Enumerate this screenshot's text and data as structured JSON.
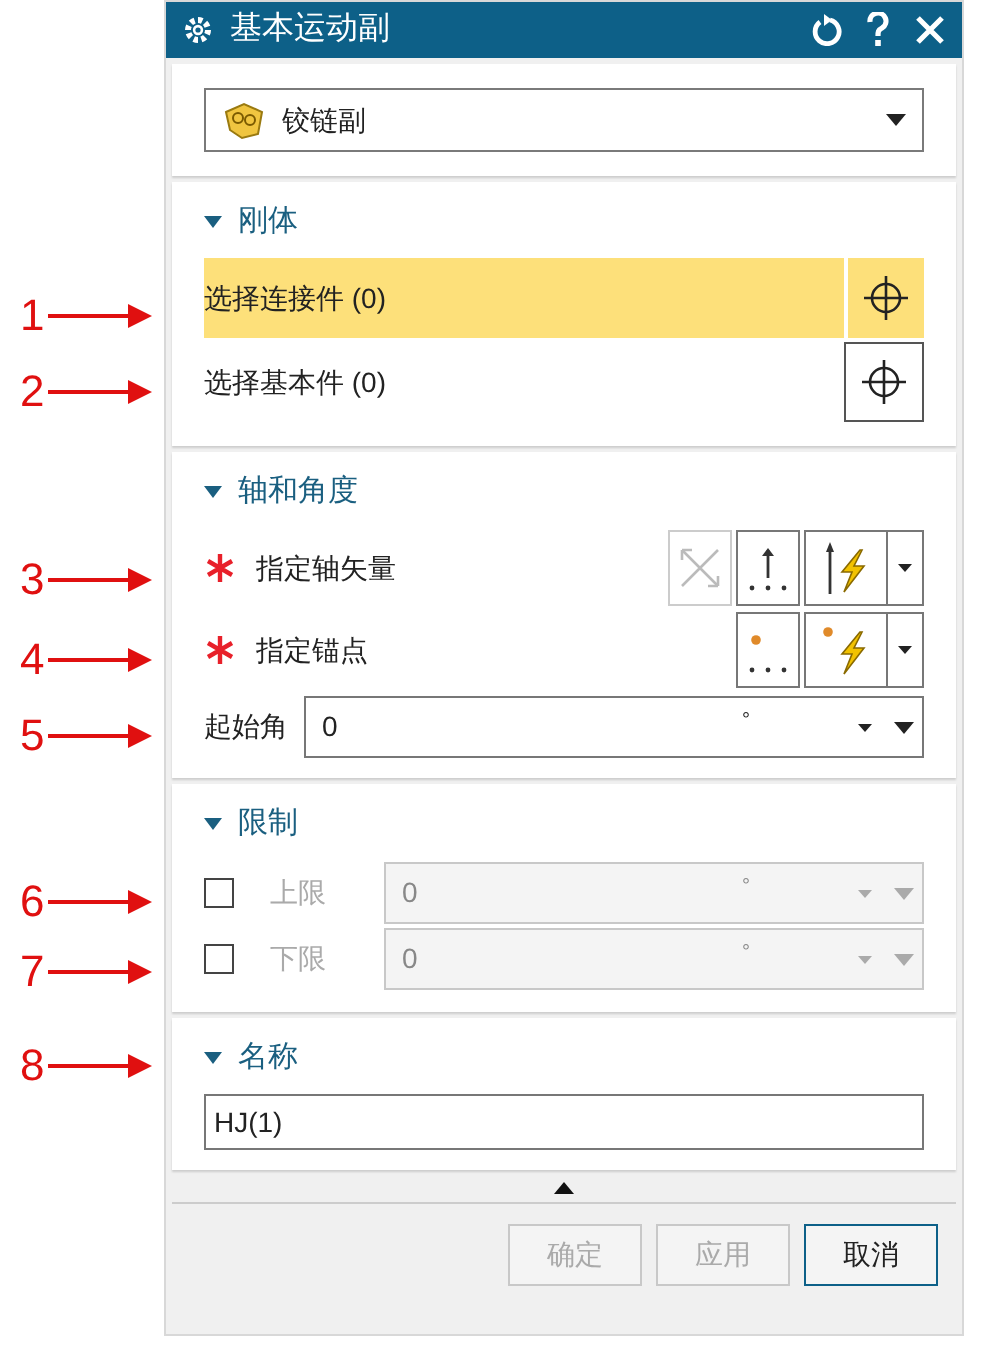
{
  "title_bar": {
    "title": "基本运动副"
  },
  "joint_type": {
    "value": "铰链副"
  },
  "sections": [
    {
      "kind": "rigid_body",
      "title": "刚体",
      "expanded": true,
      "rows": [
        {
          "label": "选择连接件 (0)",
          "selected": true
        },
        {
          "label": "选择基本件 (0)",
          "selected": false
        }
      ]
    },
    {
      "kind": "axis_angle",
      "title": "轴和角度",
      "expanded": true,
      "required": [
        {
          "kind": "vector",
          "label": "指定轴矢量"
        },
        {
          "kind": "point",
          "label": "指定锚点"
        }
      ],
      "start_angle": {
        "label": "起始角",
        "value": "0",
        "unit": "°"
      }
    },
    {
      "kind": "limits",
      "title": "限制",
      "expanded": true,
      "rows": [
        {
          "label": "上限",
          "checked": false,
          "value": "0",
          "unit": "°"
        },
        {
          "label": "下限",
          "checked": false,
          "value": "0",
          "unit": "°"
        }
      ]
    },
    {
      "kind": "name",
      "title": "名称",
      "expanded": true,
      "value": "HJ(1)"
    }
  ],
  "buttons": [
    {
      "label": "确定",
      "disabled": true
    },
    {
      "label": "应用",
      "disabled": true
    },
    {
      "label": "取消",
      "disabled": false
    }
  ],
  "callouts": [
    "1",
    "2",
    "3",
    "4",
    "5",
    "6",
    "7",
    "8"
  ]
}
